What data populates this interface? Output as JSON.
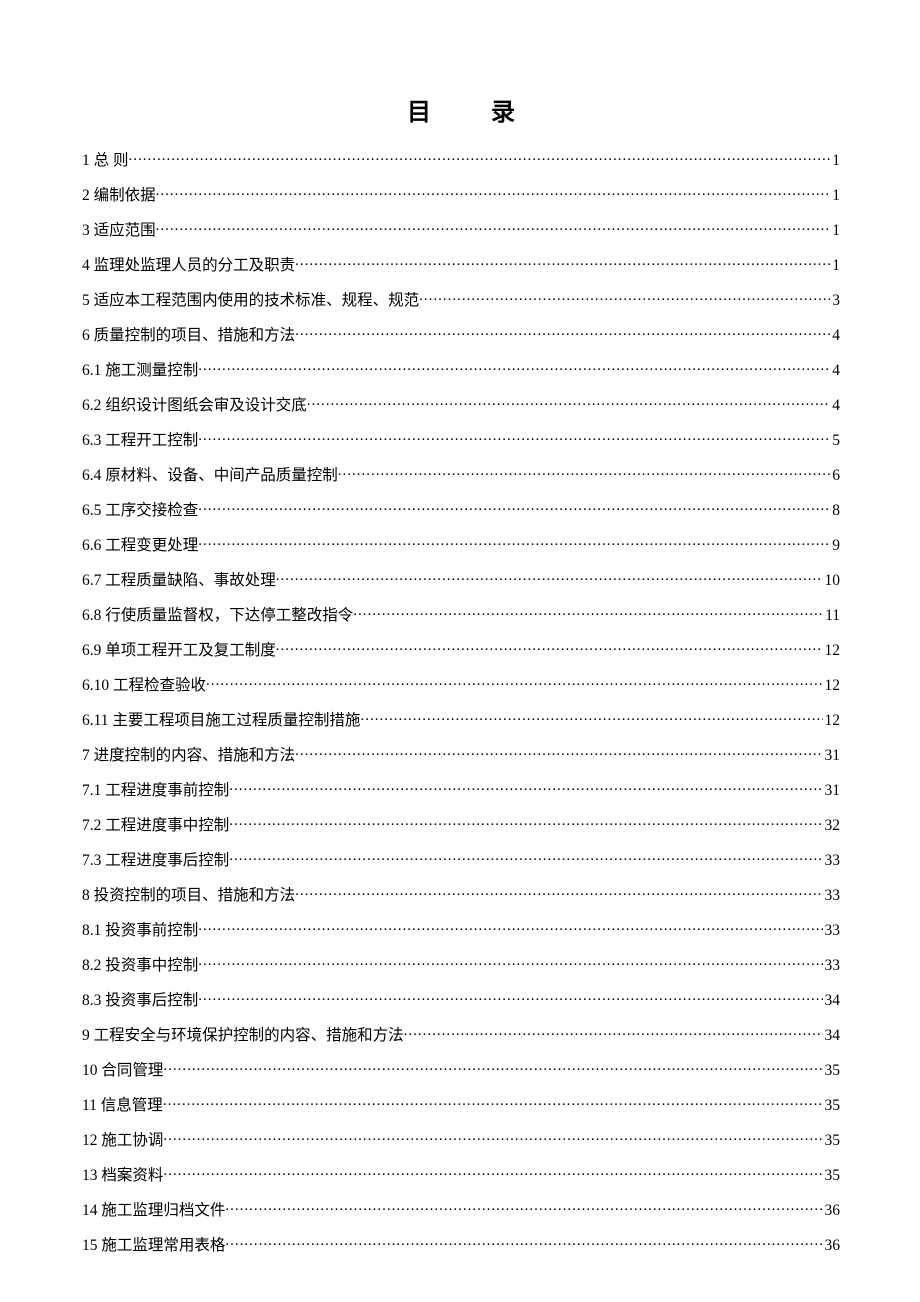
{
  "title": "目录",
  "entries": [
    {
      "label": "1   总   则",
      "page": "1"
    },
    {
      "label": "2   编制依据",
      "page": "1"
    },
    {
      "label": "3   适应范围",
      "page": "1"
    },
    {
      "label": "4 监理处监理人员的分工及职责",
      "page": "1"
    },
    {
      "label": "5 适应本工程范围内使用的技术标准、规程、规范",
      "page": "3"
    },
    {
      "label": "6 质量控制的项目、措施和方法",
      "page": "4"
    },
    {
      "label": "6.1 施工测量控制",
      "page": "4"
    },
    {
      "label": "6.2   组织设计图纸会审及设计交底",
      "page": "4"
    },
    {
      "label": "6.3  工程开工控制",
      "page": "5"
    },
    {
      "label": "6.4  原材料、设备、中间产品质量控制",
      "page": "6"
    },
    {
      "label": "6.5 工序交接检查",
      "page": "8"
    },
    {
      "label": "6.6 工程变更处理",
      "page": "9"
    },
    {
      "label": "6.7 工程质量缺陷、事故处理",
      "page": "10"
    },
    {
      "label": "6.8  行使质量监督权，下达停工整改指令",
      "page": "11"
    },
    {
      "label": "6.9  单项工程开工及复工制度",
      "page": "12"
    },
    {
      "label": "6.10  工程检查验收",
      "page": "12"
    },
    {
      "label": "6.11   主要工程项目施工过程质量控制措施",
      "page": "12"
    },
    {
      "label": "7 进度控制的内容、措施和方法",
      "page": "31"
    },
    {
      "label": "7.1   工程进度事前控制",
      "page": "31"
    },
    {
      "label": "7.2   工程进度事中控制",
      "page": "32"
    },
    {
      "label": "7.3   工程进度事后控制",
      "page": "33"
    },
    {
      "label": "8   投资控制的项目、措施和方法",
      "page": "33"
    },
    {
      "label": "8.1   投资事前控制",
      "page": "33"
    },
    {
      "label": "8.2   投资事中控制",
      "page": "33"
    },
    {
      "label": "8.3   投资事后控制",
      "page": "34"
    },
    {
      "label": "9 工程安全与环境保护控制的内容、措施和方法",
      "page": "34"
    },
    {
      "label": "10 合同管理",
      "page": "35"
    },
    {
      "label": "11 信息管理",
      "page": "35"
    },
    {
      "label": "12 施工协调",
      "page": "35"
    },
    {
      "label": "13   档案资料",
      "page": "35"
    },
    {
      "label": "14 施工监理归档文件",
      "page": "36"
    },
    {
      "label": "15 施工监理常用表格",
      "page": "36"
    }
  ]
}
